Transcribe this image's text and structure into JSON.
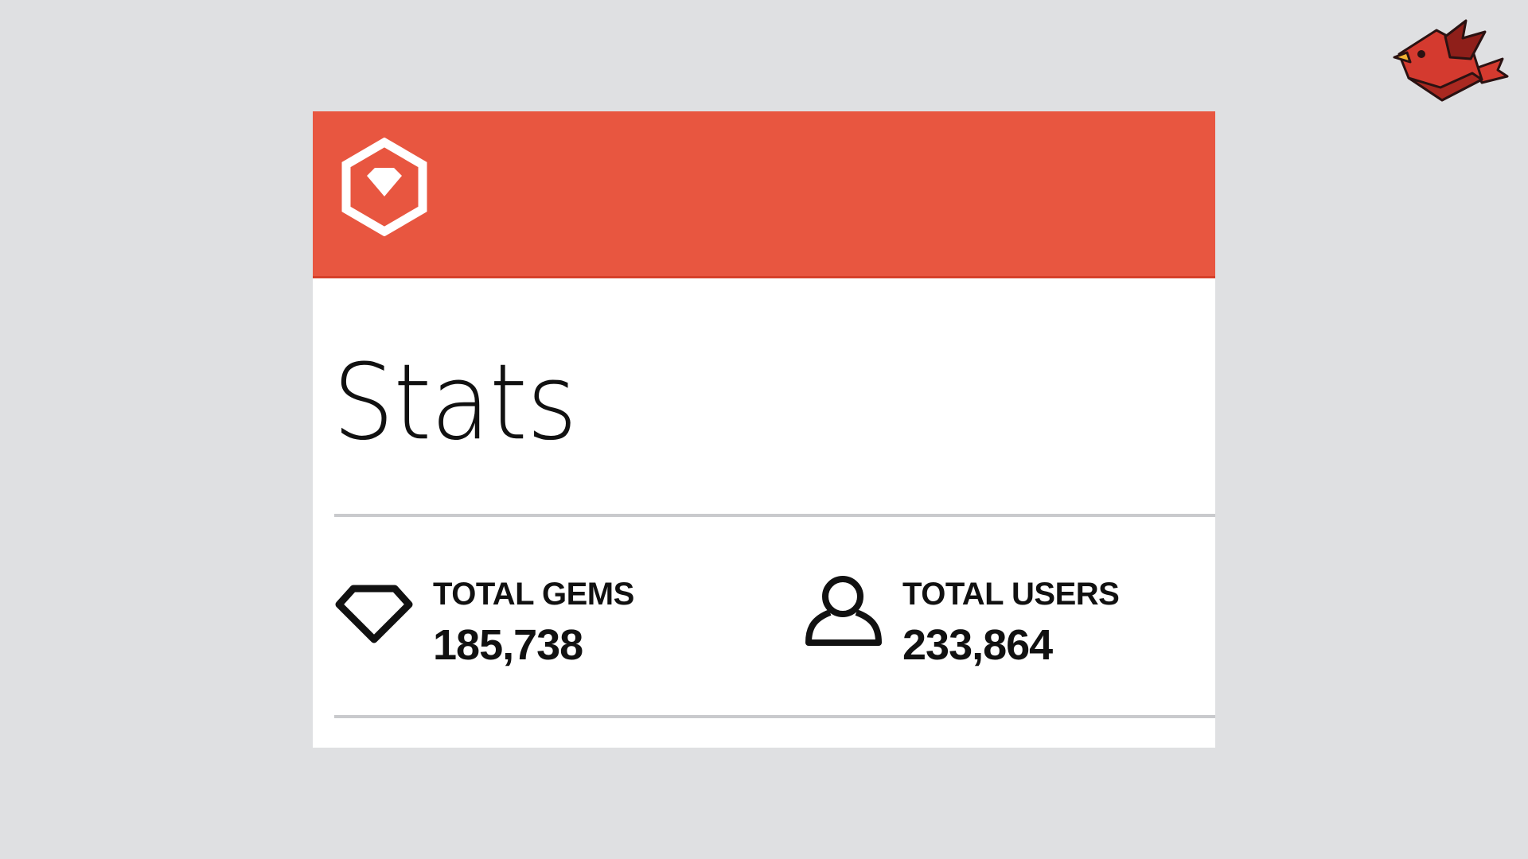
{
  "colors": {
    "background": "#dfe0e2",
    "header_accent": "#e85640",
    "card_background": "#ffffff",
    "divider": "#c9cacd",
    "text": "#111111"
  },
  "brand": {
    "corner_logo_icon": "red-bird-icon",
    "header_logo_icon": "hexagon-gem-icon"
  },
  "page": {
    "title": "Stats"
  },
  "stats": [
    {
      "icon": "gem-outline-icon",
      "label": "TOTAL GEMS",
      "value": "185,738"
    },
    {
      "icon": "user-outline-icon",
      "label": "TOTAL USERS",
      "value": "233,864"
    }
  ]
}
